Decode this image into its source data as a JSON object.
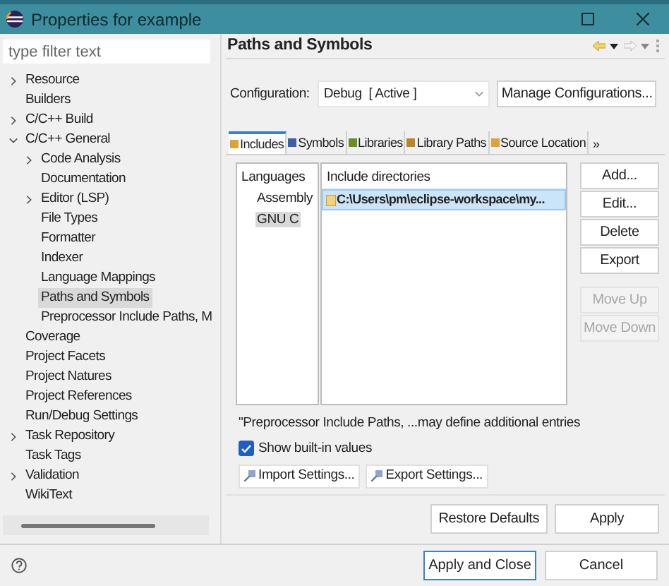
{
  "window": {
    "title": "Properties for example"
  },
  "filter": {
    "placeholder": "type filter text"
  },
  "tree": [
    {
      "label": "Resource",
      "kind": "collapsed",
      "selected": false
    },
    {
      "label": "Builders",
      "kind": "leaf",
      "selected": false
    },
    {
      "label": "C/C++ Build",
      "kind": "collapsed",
      "selected": false
    },
    {
      "label": "C/C++ General",
      "kind": "expanded",
      "selected": false,
      "children": [
        {
          "label": "Code Analysis",
          "kind": "collapsed",
          "selected": false
        },
        {
          "label": "Documentation",
          "kind": "leaf",
          "selected": false
        },
        {
          "label": "Editor (LSP)",
          "kind": "collapsed",
          "selected": false
        },
        {
          "label": "File Types",
          "kind": "leaf",
          "selected": false
        },
        {
          "label": "Formatter",
          "kind": "leaf",
          "selected": false
        },
        {
          "label": "Indexer",
          "kind": "leaf",
          "selected": false
        },
        {
          "label": "Language Mappings",
          "kind": "leaf",
          "selected": false
        },
        {
          "label": "Paths and Symbols",
          "kind": "leaf",
          "selected": true
        },
        {
          "label": "Preprocessor Include Paths, M",
          "kind": "leaf",
          "selected": false
        }
      ]
    },
    {
      "label": "Coverage",
      "kind": "leaf",
      "selected": false
    },
    {
      "label": "Project Facets",
      "kind": "leaf",
      "selected": false
    },
    {
      "label": "Project Natures",
      "kind": "leaf",
      "selected": false
    },
    {
      "label": "Project References",
      "kind": "leaf",
      "selected": false
    },
    {
      "label": "Run/Debug Settings",
      "kind": "leaf",
      "selected": false
    },
    {
      "label": "Task Repository",
      "kind": "collapsed",
      "selected": false
    },
    {
      "label": "Task Tags",
      "kind": "leaf",
      "selected": false
    },
    {
      "label": "Validation",
      "kind": "collapsed",
      "selected": false
    },
    {
      "label": "WikiText",
      "kind": "leaf",
      "selected": false
    }
  ],
  "page": {
    "title": "Paths and Symbols",
    "config_label": "Configuration:",
    "config_value": "Debug  [ Active ]",
    "manage_button": "Manage Configurations..."
  },
  "tabs": [
    {
      "label": "Includes",
      "selected": true,
      "color": "#d9a53a"
    },
    {
      "label": "Symbols",
      "selected": false,
      "color": "#3a5fa8"
    },
    {
      "label": "Libraries",
      "selected": false,
      "color": "#6b8e23"
    },
    {
      "label": "Library Paths",
      "selected": false,
      "color": "#b8862b"
    },
    {
      "label": "Source Location",
      "selected": false,
      "color": "#d9a53a"
    }
  ],
  "tab_overflow": "»",
  "languages": {
    "heading": "Languages",
    "items": [
      {
        "label": "Assembly",
        "selected": false
      },
      {
        "label": "GNU C",
        "selected": true
      }
    ]
  },
  "directories": {
    "heading": "Include directories",
    "rows": [
      {
        "path": "C:\\Users\\pm\\eclipse-workspace\\my...",
        "selected": true
      }
    ]
  },
  "side_buttons": [
    {
      "label": "Add...",
      "disabled": false
    },
    {
      "label": "Edit...",
      "disabled": false
    },
    {
      "label": "Delete",
      "disabled": false
    },
    {
      "label": "Export",
      "disabled": false
    },
    {
      "label": "Move Up",
      "disabled": true
    },
    {
      "label": "Move Down",
      "disabled": true
    }
  ],
  "note": "\"Preprocessor Include Paths, ...may define additional entries",
  "show_builtin": {
    "label": "Show built-in values",
    "checked": true
  },
  "settings_buttons": [
    "Import Settings...",
    "Export Settings..."
  ],
  "page_buttons": [
    "Restore Defaults",
    "Apply"
  ],
  "dialog_buttons": [
    {
      "label": "Apply and Close",
      "default": true
    },
    {
      "label": "Cancel",
      "default": false
    }
  ]
}
